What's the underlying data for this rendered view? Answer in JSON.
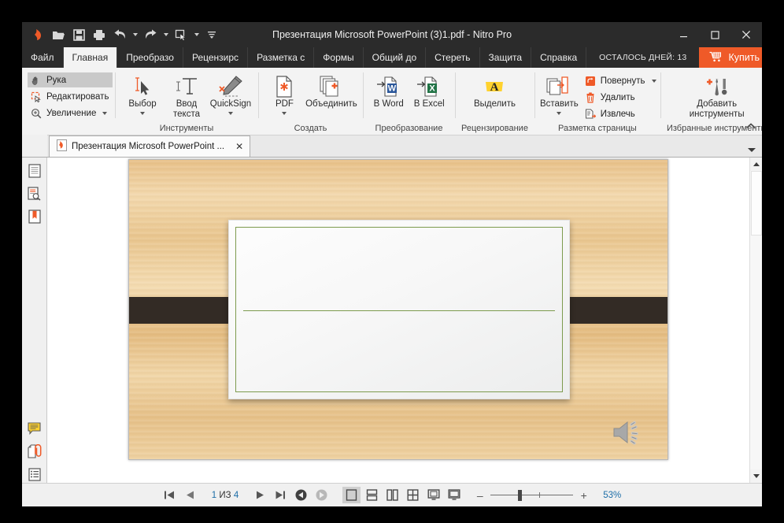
{
  "window": {
    "title": "Презентация Microsoft PowerPoint (3)1.pdf - Nitro Pro",
    "minimize": "–",
    "maximize": "□",
    "close": "✕"
  },
  "quick_access": [
    {
      "name": "nitro-logo-icon",
      "label": "Nitro"
    },
    {
      "name": "open-icon",
      "label": "Открыть"
    },
    {
      "name": "save-icon",
      "label": "Сохранить"
    },
    {
      "name": "print-icon",
      "label": "Печать"
    },
    {
      "name": "undo-icon",
      "label": "Отменить"
    },
    {
      "name": "redo-icon",
      "label": "Вернуть"
    },
    {
      "name": "select-tool-icon",
      "label": "Выбор"
    },
    {
      "name": "customize-qat-icon",
      "label": "Настроить"
    }
  ],
  "tabs": [
    {
      "label": "Файл",
      "active": false
    },
    {
      "label": "Главная",
      "active": true
    },
    {
      "label": "Преобразо",
      "active": false
    },
    {
      "label": "Рецензирс",
      "active": false
    },
    {
      "label": "Разметка с",
      "active": false
    },
    {
      "label": "Формы",
      "active": false
    },
    {
      "label": "Общий до",
      "active": false
    },
    {
      "label": "Стереть",
      "active": false
    },
    {
      "label": "Защита",
      "active": false
    },
    {
      "label": "Справка",
      "active": false
    }
  ],
  "trial": {
    "days_text": "ОСТАЛОСЬ ДНЕЙ: 13",
    "buy_label": "Купить",
    "accent_color": "#ef5a28"
  },
  "ribbon": {
    "groups": [
      {
        "label": "",
        "type": "small",
        "items": [
          {
            "label": "Рука",
            "icon": "hand-icon",
            "selected": true,
            "caret": false
          },
          {
            "label": "Редактировать",
            "icon": "edit-icon",
            "selected": false,
            "caret": false
          },
          {
            "label": "Увеличение",
            "icon": "zoom-in-icon",
            "selected": false,
            "caret": true
          }
        ]
      },
      {
        "label": "Инструменты",
        "type": "big",
        "items": [
          {
            "label": "Выбор",
            "icon": "text-select-icon",
            "caret": true
          },
          {
            "label": "Ввод текста",
            "icon": "type-text-icon",
            "caret": false
          },
          {
            "label": "QuickSign",
            "icon": "quicksign-icon",
            "caret": true
          }
        ]
      },
      {
        "label": "Создать",
        "type": "big",
        "items": [
          {
            "label": "PDF",
            "icon": "new-pdf-icon",
            "caret": true
          },
          {
            "label": "Объединить",
            "icon": "combine-icon",
            "caret": false
          }
        ]
      },
      {
        "label": "Преобразование",
        "type": "big",
        "items": [
          {
            "label": "В Word",
            "icon": "to-word-icon",
            "caret": false
          },
          {
            "label": "В Excel",
            "icon": "to-excel-icon",
            "caret": false
          }
        ]
      },
      {
        "label": "Рецензирование",
        "type": "big",
        "items": [
          {
            "label": "Выделить",
            "icon": "highlight-icon",
            "caret": false
          }
        ]
      },
      {
        "label": "Разметка страницы",
        "type": "mixed",
        "items": [
          {
            "label": "Вставить",
            "icon": "insert-pages-icon",
            "caret": true
          },
          {
            "label": "Повернуть",
            "icon": "rotate-icon",
            "caret": true
          },
          {
            "label": "Удалить",
            "icon": "delete-icon",
            "caret": false
          },
          {
            "label": "Извлечь",
            "icon": "extract-icon",
            "caret": false
          }
        ]
      },
      {
        "label": "Избранные инструменты",
        "type": "big",
        "items": [
          {
            "label": "Добавить инструменты",
            "icon": "add-tools-icon",
            "caret": false
          }
        ]
      }
    ],
    "collapse_label": "^"
  },
  "document_tab": {
    "title": "Презентация Microsoft PowerPoint ...",
    "close_label": "✕",
    "icon": "pdf-file-icon"
  },
  "left_sidebar": {
    "top_items": [
      {
        "name": "pages-panel-icon",
        "label": "Страницы"
      },
      {
        "name": "ocr-search-panel-icon",
        "label": "Поиск"
      },
      {
        "name": "bookmarks-panel-icon",
        "label": "Закладки"
      }
    ],
    "bottom_items": [
      {
        "name": "comments-panel-icon",
        "label": "Комментарии"
      },
      {
        "name": "attachments-panel-icon",
        "label": "Вложения"
      },
      {
        "name": "layers-panel-icon",
        "label": "Слои"
      }
    ]
  },
  "slide": {
    "background_colors": [
      "#e8c189",
      "#f4dcb2",
      "#e4bc81"
    ],
    "band_color": "#332b25",
    "card_border_color": "#7d9b4e",
    "audio_icon": "speaker-icon"
  },
  "statusbar": {
    "nav": [
      {
        "name": "first-page-button",
        "glyph": "|◀"
      },
      {
        "name": "previous-page-button",
        "glyph": "◀"
      }
    ],
    "page_current": "1",
    "page_of": "ИЗ",
    "page_total": "4",
    "nav_right": [
      {
        "name": "next-page-button",
        "glyph": "▶"
      },
      {
        "name": "last-page-button",
        "glyph": "▶|"
      },
      {
        "name": "previous-view-button",
        "glyph": "◀"
      },
      {
        "name": "next-view-button",
        "glyph": "▶"
      }
    ],
    "views": [
      {
        "name": "view-single-page",
        "active": true
      },
      {
        "name": "view-two-rows",
        "active": false
      },
      {
        "name": "view-two-columns",
        "active": false
      },
      {
        "name": "view-grid",
        "active": false
      },
      {
        "name": "view-fit-page",
        "active": false
      },
      {
        "name": "view-fit-width",
        "active": false
      }
    ],
    "zoom_out": "–",
    "zoom_in": "+",
    "zoom_value": "53%"
  }
}
